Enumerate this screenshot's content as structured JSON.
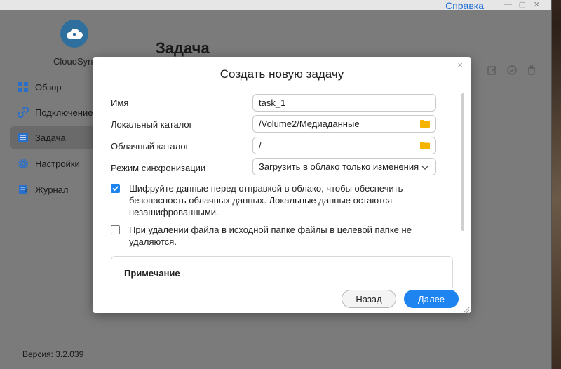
{
  "topbar": {
    "link_label": "Справка"
  },
  "app": {
    "name": "CloudSync",
    "version_label": "Версия: 3.2.039"
  },
  "page": {
    "title": "Задача"
  },
  "sidebar": {
    "items": [
      {
        "label": "Обзор",
        "icon": "grid-icon"
      },
      {
        "label": "Подключение",
        "icon": "link-icon"
      },
      {
        "label": "Задача",
        "icon": "task-list-icon",
        "active": true
      },
      {
        "label": "Настройки",
        "icon": "gear-icon"
      },
      {
        "label": "Журнал",
        "icon": "log-icon"
      }
    ]
  },
  "modal": {
    "title": "Создать новую задачу",
    "close_label": "×",
    "fields": {
      "name": {
        "label": "Имя",
        "value": "task_1"
      },
      "local_dir": {
        "label": "Локальный каталог",
        "value": "/Volume2/Медиаданные"
      },
      "cloud_dir": {
        "label": "Облачный каталог",
        "value": "/"
      },
      "sync_mode": {
        "label": "Режим синхронизации",
        "value": "Загрузить в облако только изменения"
      }
    },
    "options": {
      "encrypt": {
        "checked": true,
        "text": "Шифруйте данные перед отправкой в облако, чтобы обеспечить безопасность облачных данных. Локальные данные остаются незашифрованными."
      },
      "keep_on_delete": {
        "checked": false,
        "text": "При удалении файла в исходной папке файлы в целевой папке не удаляются."
      }
    },
    "note_title": "Примечание",
    "back_label": "Назад",
    "next_label": "Далее"
  },
  "colors": {
    "accent": "#1e84f0",
    "folder": "#f5b400"
  }
}
